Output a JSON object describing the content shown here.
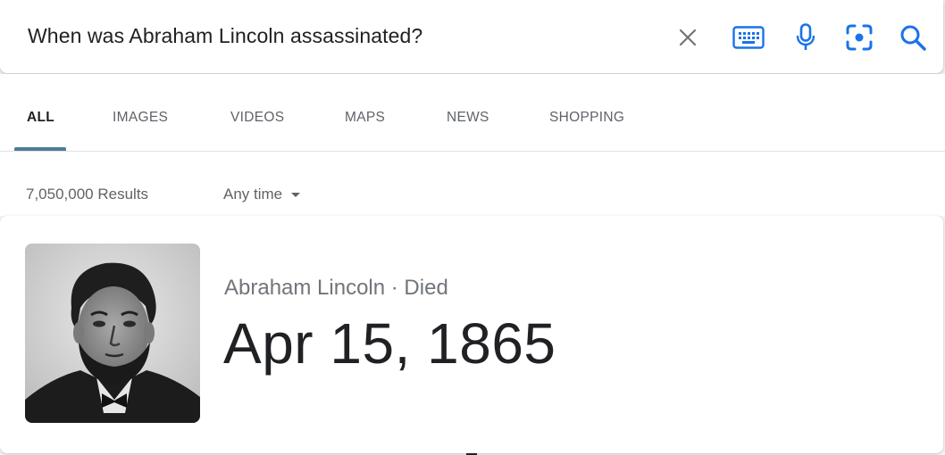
{
  "search": {
    "query": "When was Abraham Lincoln assassinated?",
    "icons": [
      "close-icon",
      "keyboard-icon",
      "microphone-icon",
      "lens-icon",
      "search-icon"
    ]
  },
  "tabs": [
    {
      "label": "ALL",
      "active": true
    },
    {
      "label": "IMAGES",
      "active": false
    },
    {
      "label": "VIDEOS",
      "active": false
    },
    {
      "label": "MAPS",
      "active": false
    },
    {
      "label": "NEWS",
      "active": false
    },
    {
      "label": "SHOPPING",
      "active": false
    }
  ],
  "results": {
    "count_text": "7,050,000 Results",
    "time_filter": "Any time"
  },
  "answer_card": {
    "subject": "Abraham Lincoln · Died",
    "answer": "Apr 15, 1865"
  },
  "colors": {
    "accent": "#4d7b97",
    "icon_blue": "#1a73e8",
    "icon_grey": "#70757a"
  }
}
